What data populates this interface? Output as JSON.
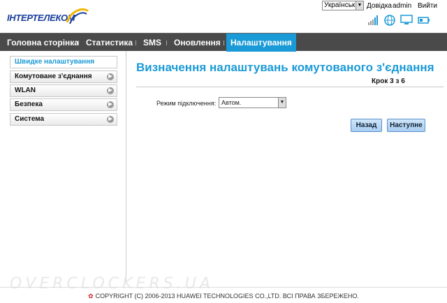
{
  "header": {
    "logo_text": "ІНТЕРТЕЛЕКОМ",
    "language": "Українська",
    "links": [
      "Довідка",
      "admin",
      "Вийти"
    ],
    "icons": [
      "signal-icon",
      "globe-icon",
      "monitor-icon",
      "battery-icon"
    ]
  },
  "nav": {
    "items": [
      "Головна сторінка",
      "Статистика",
      "SMS",
      "Оновлення",
      "Налаштування"
    ],
    "active": "Налаштування"
  },
  "sidebar": {
    "items": [
      "Швидке налаштування",
      "Комутоване з'єднання",
      "WLAN",
      "Безпека",
      "Система"
    ],
    "active": "Швидке налаштування"
  },
  "main": {
    "title": "Визначення налаштувань комутованого з'єднання",
    "step": "Крок 3 з 6",
    "mode_label": "Режим підключення:",
    "mode_value": "Автом.",
    "back_label": "Назад",
    "next_label": "Наступне"
  },
  "footer": {
    "copyright": "COPYRIGHT (C) 2006-2013 HUAWEI TECHNOLOGIES CO.,LTD. ВСІ ПРАВА ЗБЕРЕЖЕНО.",
    "watermark": "OVERCLOCKERS.UA"
  },
  "colors": {
    "accent": "#1a9ad6",
    "nav_bg": "#4a4a4a",
    "logo": "#1a3e9c"
  }
}
